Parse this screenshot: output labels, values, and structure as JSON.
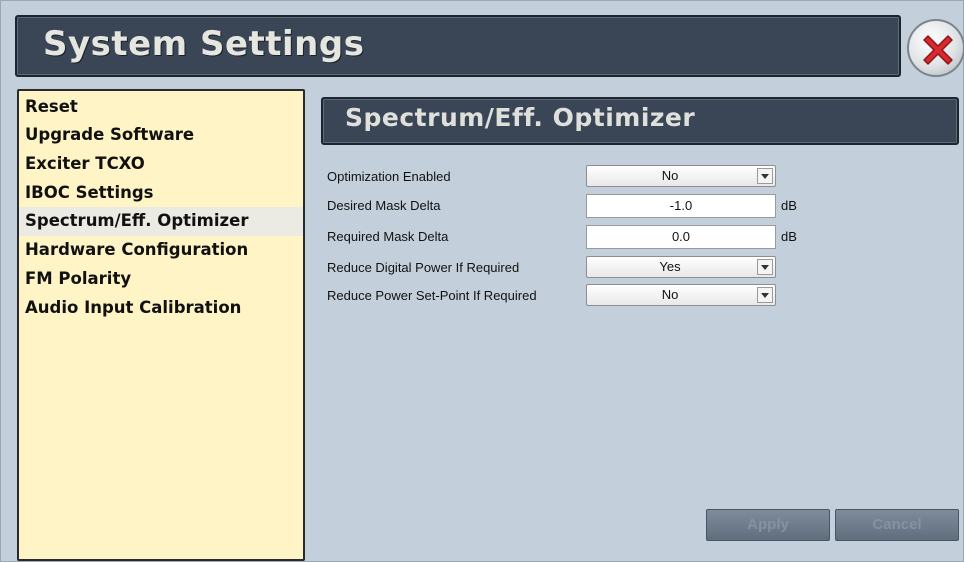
{
  "window": {
    "title": "System Settings",
    "close_icon": "close-x-icon"
  },
  "sidebar": {
    "items": [
      {
        "label": "Reset"
      },
      {
        "label": "Upgrade Software"
      },
      {
        "label": "Exciter TCXO"
      },
      {
        "label": "IBOC Settings"
      },
      {
        "label": "Spectrum/Eff. Optimizer",
        "active": true
      },
      {
        "label": "Hardware Configuration"
      },
      {
        "label": "FM Polarity"
      },
      {
        "label": "Audio Input Calibration"
      }
    ]
  },
  "panel": {
    "title": "Spectrum/Eff. Optimizer",
    "fields": [
      {
        "label": "Optimization Enabled",
        "type": "select",
        "value": "No"
      },
      {
        "label": "Desired Mask Delta",
        "type": "text",
        "value": "-1.0",
        "unit": "dB"
      },
      {
        "label": "Required Mask Delta",
        "type": "text",
        "value": "0.0",
        "unit": "dB"
      },
      {
        "label": "Reduce Digital Power If Required",
        "type": "select",
        "value": "Yes"
      },
      {
        "label": "Reduce Power Set-Point If Required",
        "type": "select",
        "value": "No"
      }
    ]
  },
  "buttons": {
    "apply": "Apply",
    "cancel": "Cancel"
  },
  "colors": {
    "background": "#c3d0db",
    "header": "#3a4656",
    "sidebar": "#fff4c6",
    "close_red": "#d8292f"
  }
}
